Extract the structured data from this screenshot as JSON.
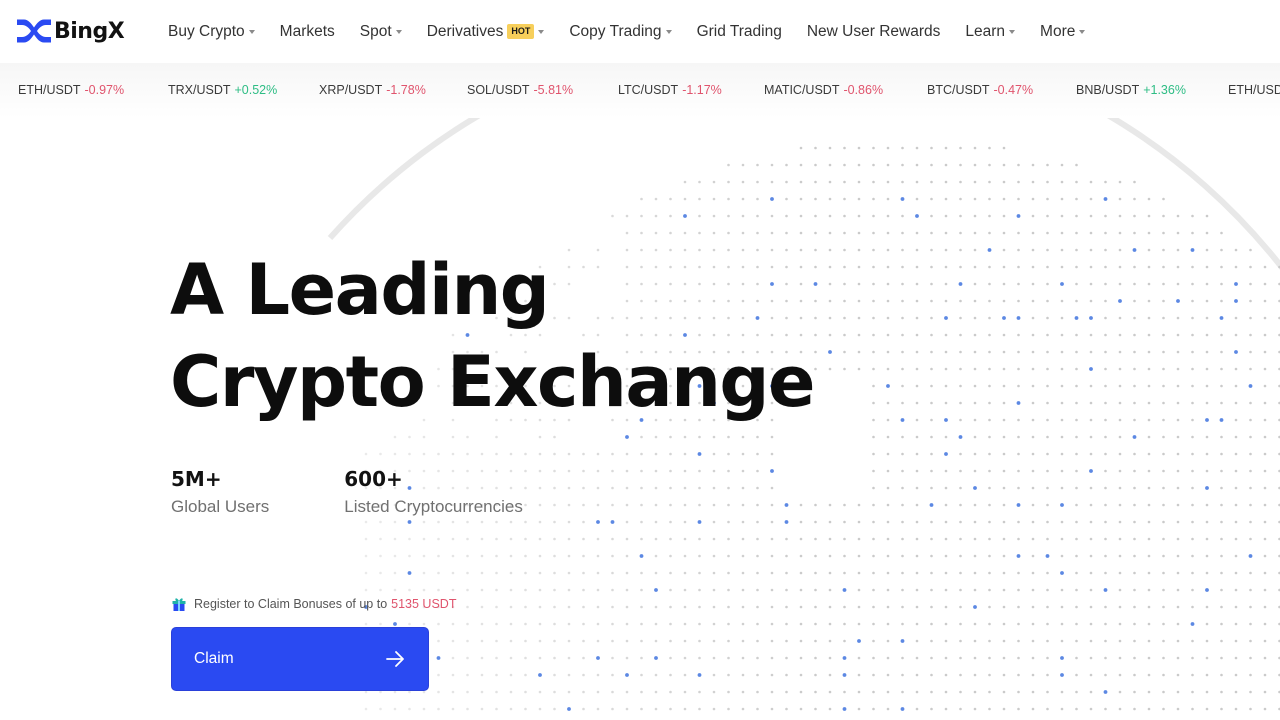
{
  "brand": {
    "name": "BingX",
    "logo_icon": "bingx-x-logo-icon",
    "accent_color": "#2a4af2"
  },
  "nav": {
    "items": [
      {
        "label": "Buy Crypto",
        "has_dropdown": true
      },
      {
        "label": "Markets",
        "has_dropdown": false
      },
      {
        "label": "Spot",
        "has_dropdown": true
      },
      {
        "label": "Derivatives",
        "has_dropdown": true,
        "badge": "HOT"
      },
      {
        "label": "Copy Trading",
        "has_dropdown": true
      },
      {
        "label": "Grid Trading",
        "has_dropdown": false
      },
      {
        "label": "New User Rewards",
        "has_dropdown": false
      },
      {
        "label": "Learn",
        "has_dropdown": true
      },
      {
        "label": "More",
        "has_dropdown": true
      }
    ]
  },
  "ticker": {
    "items": [
      {
        "pair": "ETH/USDT",
        "change": "-0.97%",
        "direction": "down"
      },
      {
        "pair": "TRX/USDT",
        "change": "+0.52%",
        "direction": "up"
      },
      {
        "pair": "XRP/USDT",
        "change": "-1.78%",
        "direction": "down"
      },
      {
        "pair": "SOL/USDT",
        "change": "-5.81%",
        "direction": "down"
      },
      {
        "pair": "LTC/USDT",
        "change": "-1.17%",
        "direction": "down"
      },
      {
        "pair": "MATIC/USDT",
        "change": "-0.86%",
        "direction": "down"
      },
      {
        "pair": "BTC/USDT",
        "change": "-0.47%",
        "direction": "down"
      },
      {
        "pair": "BNB/USDT",
        "change": "+1.36%",
        "direction": "up"
      },
      {
        "pair": "ETH/USDT",
        "change": "",
        "direction": "down"
      }
    ],
    "colors": {
      "down": "#e0546d",
      "up": "#2ebd85"
    }
  },
  "hero": {
    "title_line1": "A Leading",
    "title_line2": "Crypto Exchange",
    "stats": [
      {
        "value": "5M+",
        "label": "Global Users"
      },
      {
        "value": "600+",
        "label": "Listed Cryptocurrencies"
      }
    ],
    "bonus": {
      "icon": "gift-icon",
      "text": "Register to Claim Bonuses of up to",
      "amount": "5135 USDT"
    },
    "cta": {
      "label": "Claim",
      "icon": "arrow-right-icon"
    }
  },
  "background": {
    "graphic": "dotted-globe-illustration"
  }
}
